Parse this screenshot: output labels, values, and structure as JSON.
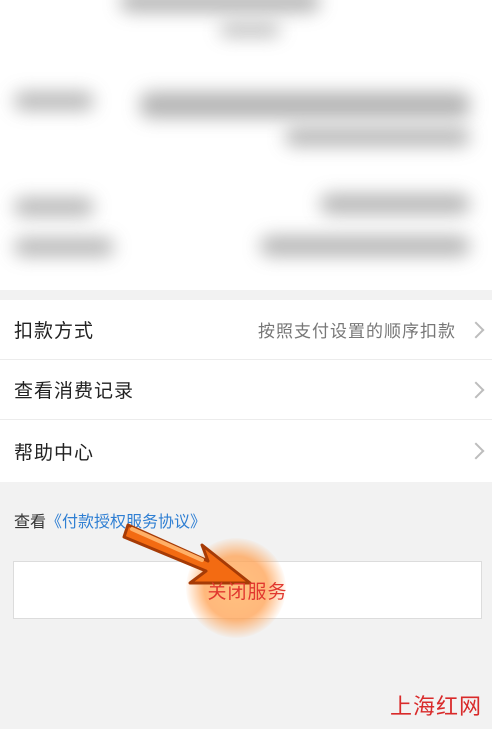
{
  "menu": {
    "items": [
      {
        "label": "扣款方式",
        "value": "按照支付设置的顺序扣款"
      },
      {
        "label": "查看消费记录",
        "value": ""
      },
      {
        "label": "帮助中心",
        "value": ""
      }
    ]
  },
  "agreement": {
    "prefix": "查看",
    "link": "《付款授权服务协议》"
  },
  "close_button": {
    "label": "关闭服务"
  },
  "watermark": "上海红网",
  "colors": {
    "link": "#2f7fd3",
    "close_text": "#e1382f",
    "arrow": "#f36b12",
    "watermark": "#d92a2a"
  }
}
